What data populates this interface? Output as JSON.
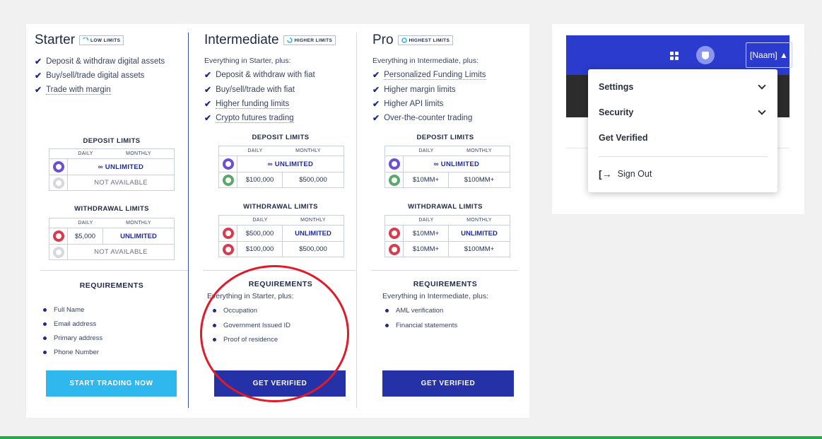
{
  "colors": {
    "accent": "#2531a6",
    "cyan": "#2fb8ee",
    "highlight_circle": "#e11a2a",
    "nav": "#2a3bcd",
    "green_line": "#1eae4b"
  },
  "plans": [
    {
      "name": "Starter",
      "badge": "LOW LIMITS",
      "plus": "",
      "features": [
        "Deposit & withdraw digital assets",
        "Buy/sell/trade digital assets",
        "Trade with margin"
      ],
      "deposit_title": "DEPOSIT LIMITS",
      "daily": "DAILY",
      "monthly": "MONTHLY",
      "deposit_crypto": "∞ UNLIMITED",
      "deposit_fiat": "NOT AVAILABLE",
      "withdrawal_title": "WITHDRAWAL LIMITS",
      "withdraw_crypto_daily": "$5,000",
      "withdraw_crypto_monthly": "UNLIMITED",
      "withdraw_fiat": "NOT AVAILABLE",
      "requirements_title": "REQUIREMENTS",
      "req_plus": "",
      "requirements": [
        "Full Name",
        "Email address",
        "Primary address",
        "Phone Number"
      ],
      "button": "START TRADING NOW"
    },
    {
      "name": "Intermediate",
      "badge": "HIGHER LIMITS",
      "plus": "Everything in Starter, plus:",
      "features": [
        "Deposit & withdraw with fiat",
        "Buy/sell/trade with fiat",
        "Higher funding limits",
        "Crypto futures trading"
      ],
      "deposit_title": "DEPOSIT LIMITS",
      "daily": "DAILY",
      "monthly": "MONTHLY",
      "deposit_crypto": "∞ UNLIMITED",
      "deposit_fiat_daily": "$100,000",
      "deposit_fiat_monthly": "$500,000",
      "withdrawal_title": "WITHDRAWAL LIMITS",
      "withdraw_crypto_daily": "$500,000",
      "withdraw_crypto_monthly": "UNLIMITED",
      "withdraw_fiat_daily": "$100,000",
      "withdraw_fiat_monthly": "$500,000",
      "requirements_title": "REQUIREMENTS",
      "req_plus": "Everything in Starter, plus:",
      "requirements": [
        "Occupation",
        "Government Issued ID",
        "Proof of residence"
      ],
      "button": "GET VERIFIED"
    },
    {
      "name": "Pro",
      "badge": "HIGHEST LIMITS",
      "plus": "Everything in Intermediate, plus:",
      "features": [
        "Personalized Funding Limits",
        "Higher margin limits",
        "Higher API limits",
        "Over-the-counter trading"
      ],
      "deposit_title": "DEPOSIT LIMITS",
      "daily": "DAILY",
      "monthly": "MONTHLY",
      "deposit_crypto": "∞ UNLIMITED",
      "deposit_fiat_daily": "$10MM+",
      "deposit_fiat_monthly": "$100MM+",
      "withdrawal_title": "WITHDRAWAL LIMITS",
      "withdraw_crypto_daily": "$10MM+",
      "withdraw_crypto_monthly": "UNLIMITED",
      "withdraw_fiat_daily": "$10MM+",
      "withdraw_fiat_monthly": "$100MM+",
      "requirements_title": "REQUIREMENTS",
      "req_plus": "Everything in Intermediate, plus:",
      "requirements": [
        "AML verification",
        "Financial statements"
      ],
      "button": "GET VERIFIED"
    }
  ],
  "account": {
    "button": "[Naam] ▲",
    "menu": {
      "settings": "Settings",
      "security": "Security",
      "get_verified": "Get Verified",
      "sign_out_icon": "[→",
      "sign_out": "Sign Out"
    },
    "icons": [
      "grid-icon",
      "shield-icon",
      "chevron-down-icon",
      "sign-out-icon"
    ]
  }
}
